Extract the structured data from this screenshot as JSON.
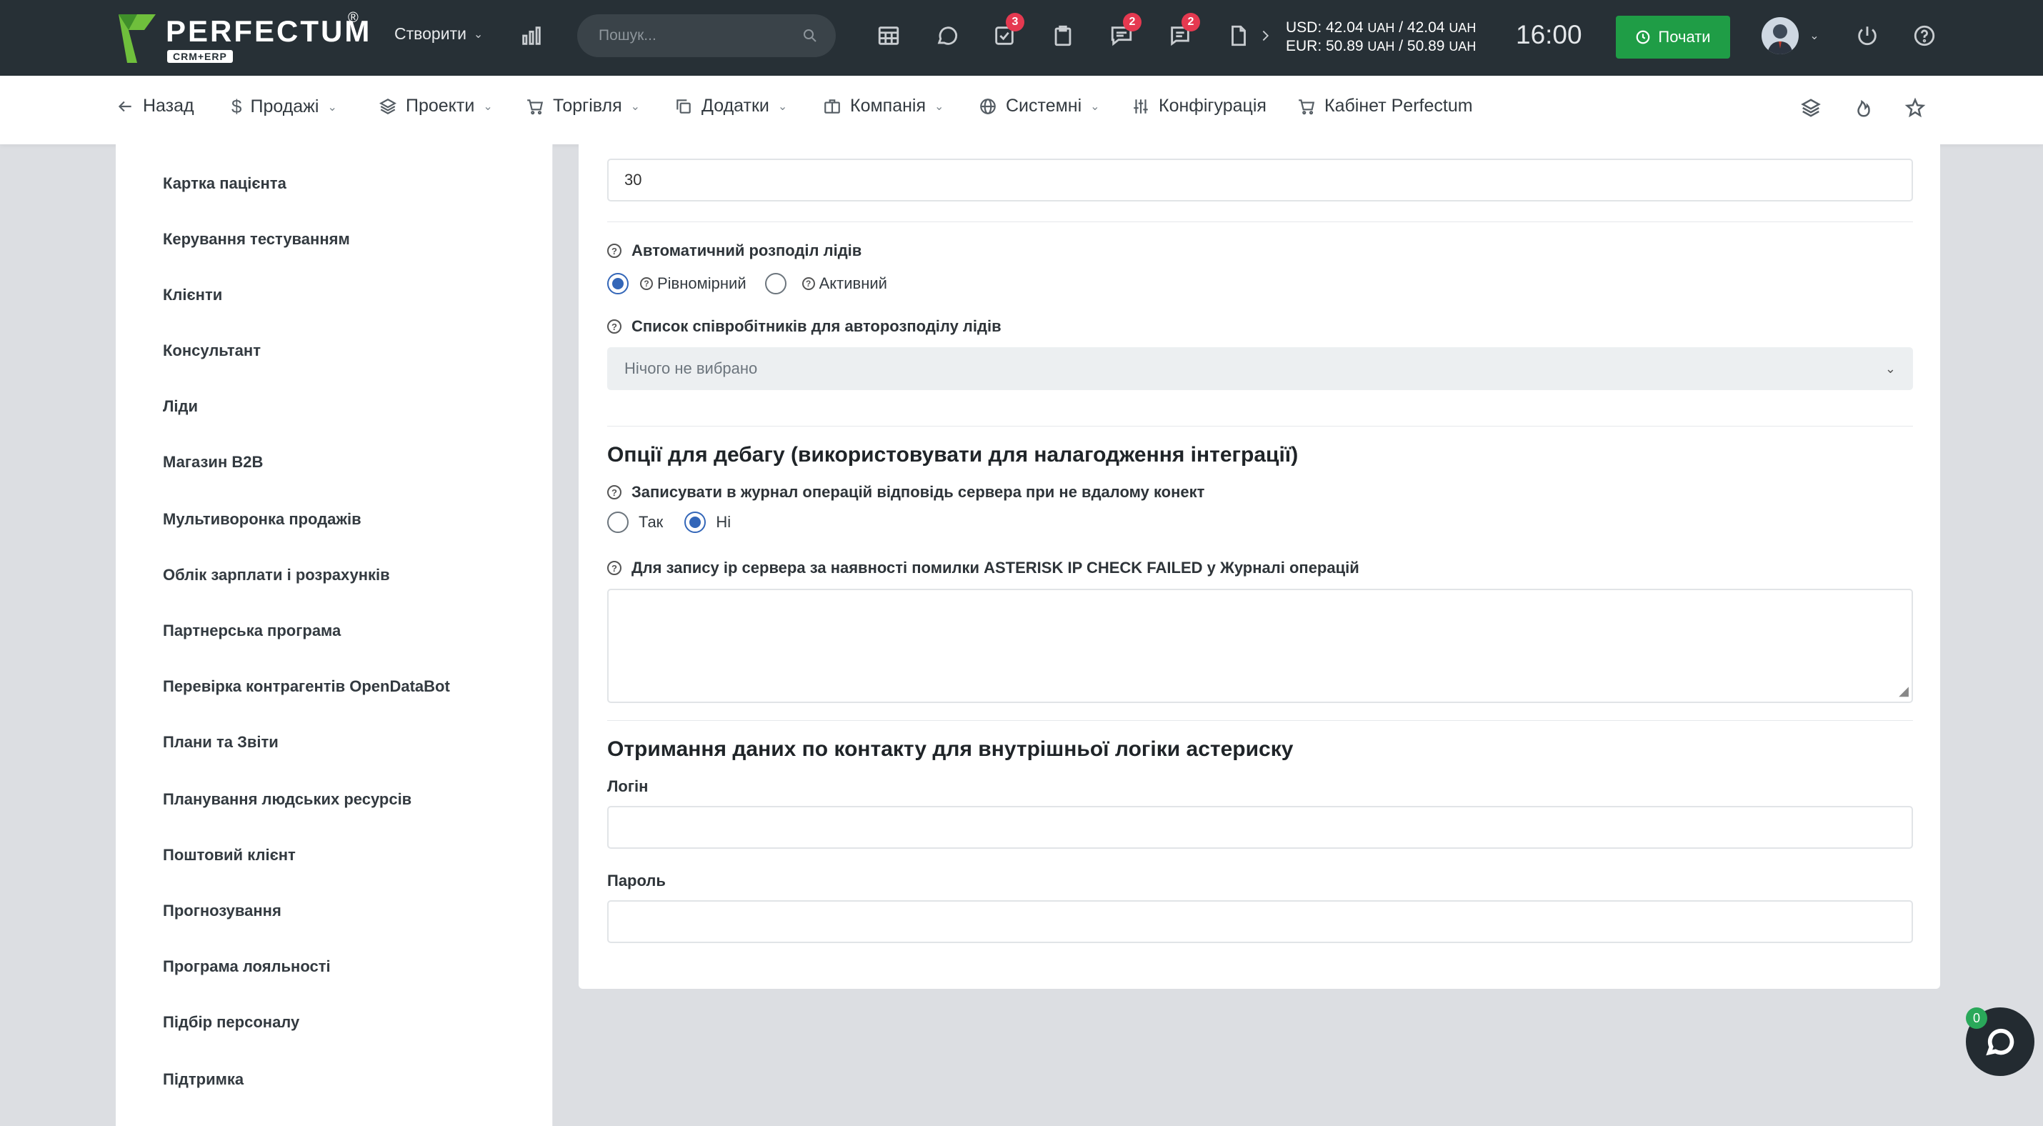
{
  "brand": {
    "name": "PERFECTUM",
    "reg": "®",
    "sub": "CRM+ERP"
  },
  "topbar": {
    "create_label": "Створити",
    "search_placeholder": "Пошук...",
    "badges": {
      "tasks": "3",
      "chat": "2",
      "messages": "2"
    },
    "currency": {
      "usd_prefix": "USD: 42.04 ",
      "usd_unit1": "UAH",
      "usd_sep": " / 42.04 ",
      "usd_unit2": "UAH",
      "eur_prefix": "EUR: 50.89 ",
      "eur_unit1": "UAH",
      "eur_sep": " / 50.89 ",
      "eur_unit2": "UAH"
    },
    "time": "16:00",
    "start_label": "Почати"
  },
  "nav": {
    "back": "Назад",
    "sales": "Продажі",
    "projects": "Проекти",
    "trade": "Торгівля",
    "addons": "Додатки",
    "company": "Компанія",
    "system": "Системні",
    "config": "Конфігурація",
    "cabinet": "Кабінет Perfectum"
  },
  "sidebar": {
    "items": [
      "Картка пацієнта",
      "Керування тестуванням",
      "Клієнти",
      "Консультант",
      "Ліди",
      "Магазин B2B",
      "Мультиворонка продажів",
      "Облік зарплати і розрахунків",
      "Партнерська програма",
      "Перевірка контрагентів OpenDataBot",
      "Плани та Звіти",
      "Планування людських ресурсів",
      "Поштовий клієнт",
      "Прогнозування",
      "Програма лояльності",
      "Підбір персоналу",
      "Підтримка"
    ]
  },
  "form": {
    "top_value": "30",
    "auto_dist_label": "Автоматичний розподіл лідів",
    "auto_dist_opt1": "Рівномірний",
    "auto_dist_opt2": "Активний",
    "staff_list_label": "Список співробітників для авторозподілу лідів",
    "staff_list_value": "Нічого не вибрано",
    "debug_title": "Опції для дебагу (використовувати для налагодження інтеграції)",
    "log_label": "Записувати в журнал операцій відповідь сервера при не вдалому конект",
    "yes": "Так",
    "no": "Ні",
    "ip_label": "Для запису ip сервера за наявності помилки ASTERISK IP CHECK FAILED у Журналі операцій",
    "contact_title": "Отримання даних по контакту для внутрішньої логіки астериску",
    "login_label": "Логін",
    "password_label": "Пароль"
  },
  "chat": {
    "count": "0"
  }
}
